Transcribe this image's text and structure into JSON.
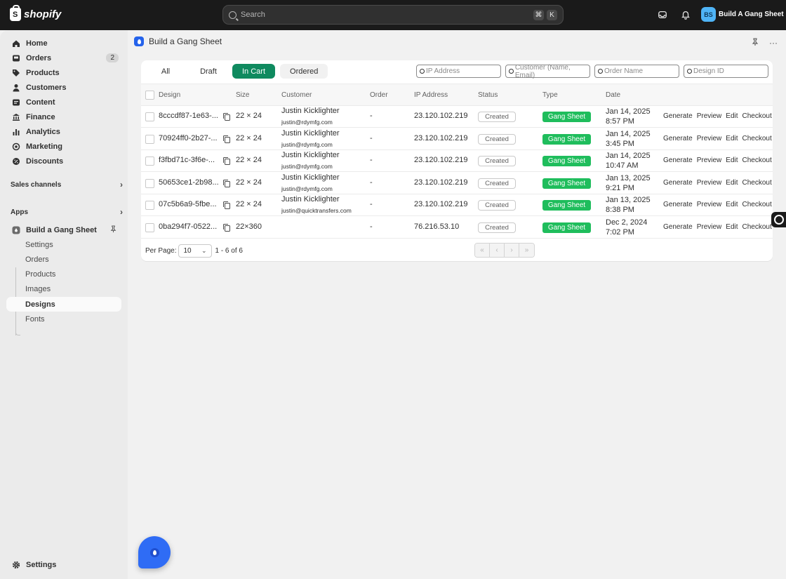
{
  "topbar": {
    "logo_text": "shopify",
    "logo_glyph": "S",
    "search_placeholder": "Search",
    "shortcut_keys": [
      "⌘",
      "K"
    ],
    "store_initials": "BS",
    "store_name": "Build A Gang Sheet"
  },
  "sidebar": {
    "nav": [
      {
        "label": "Home",
        "icon": "home-icon"
      },
      {
        "label": "Orders",
        "icon": "orders-icon",
        "badge": "2"
      },
      {
        "label": "Products",
        "icon": "tag-icon"
      },
      {
        "label": "Customers",
        "icon": "person-icon"
      },
      {
        "label": "Content",
        "icon": "content-icon"
      },
      {
        "label": "Finance",
        "icon": "bank-icon"
      },
      {
        "label": "Analytics",
        "icon": "bar-chart-icon"
      },
      {
        "label": "Marketing",
        "icon": "target-icon"
      },
      {
        "label": "Discounts",
        "icon": "discount-icon"
      }
    ],
    "sales_channels_label": "Sales channels",
    "apps_label": "Apps",
    "app_name": "Build a Gang Sheet",
    "app_sub_items": [
      "Settings",
      "Orders",
      "Products",
      "Images",
      "Designs",
      "Fonts"
    ],
    "active_sub_item": "Designs",
    "settings_label": "Settings"
  },
  "page": {
    "title": "Build a Gang Sheet",
    "more_label": "···"
  },
  "tabs": [
    {
      "label": "All",
      "state": "ghost"
    },
    {
      "label": "Draft",
      "state": "ghost"
    },
    {
      "label": "In Cart",
      "state": "active"
    },
    {
      "label": "Ordered",
      "state": "plain"
    }
  ],
  "filters": {
    "ip_placeholder": "IP Address",
    "customer_placeholder": "Customer (Name, Email)",
    "order_placeholder": "Order Name",
    "design_placeholder": "Design ID"
  },
  "table": {
    "headers": {
      "design": "Design",
      "size": "Size",
      "customer": "Customer",
      "order": "Order",
      "ip": "IP Address",
      "status": "Status",
      "type": "Type",
      "date": "Date"
    },
    "actions": [
      "Generate",
      "Preview",
      "Edit",
      "Checkout"
    ],
    "rows": [
      {
        "design": "8cccdf87-1e63-...",
        "size": "22 × 24",
        "customer_name": "Justin Kicklighter",
        "customer_email": "justin@rdymfg.com",
        "order": "-",
        "ip": "23.120.102.219",
        "status": "Created",
        "type": "Gang Sheet",
        "date_line1": "Jan 14, 2025",
        "date_line2": "8:57 PM"
      },
      {
        "design": "70924ff0-2b27-...",
        "size": "22 × 24",
        "customer_name": "Justin Kicklighter",
        "customer_email": "justin@rdymfg.com",
        "order": "-",
        "ip": "23.120.102.219",
        "status": "Created",
        "type": "Gang Sheet",
        "date_line1": "Jan 14, 2025",
        "date_line2": "3:45 PM"
      },
      {
        "design": "f3fbd71c-3f6e-...",
        "size": "22 × 24",
        "customer_name": "Justin Kicklighter",
        "customer_email": "justin@rdymfg.com",
        "order": "-",
        "ip": "23.120.102.219",
        "status": "Created",
        "type": "Gang Sheet",
        "date_line1": "Jan 14, 2025",
        "date_line2": "10:47 AM"
      },
      {
        "design": "50653ce1-2b98...",
        "size": "22 × 24",
        "customer_name": "Justin Kicklighter",
        "customer_email": "justin@rdymfg.com",
        "order": "-",
        "ip": "23.120.102.219",
        "status": "Created",
        "type": "Gang Sheet",
        "date_line1": "Jan 13, 2025",
        "date_line2": "9:21 PM"
      },
      {
        "design": "07c5b6a9-5fbe...",
        "size": "22 × 24",
        "customer_name": "Justin Kicklighter",
        "customer_email": "justin@quicktransfers.com",
        "order": "-",
        "ip": "23.120.102.219",
        "status": "Created",
        "type": "Gang Sheet",
        "date_line1": "Jan 13, 2025",
        "date_line2": "8:38 PM"
      },
      {
        "design": "0ba294f7-0522...",
        "size": "22×360",
        "customer_name": "",
        "customer_email": "",
        "order": "-",
        "ip": "76.216.53.10",
        "status": "Created",
        "type": "Gang Sheet",
        "date_line1": "Dec 2, 2024",
        "date_line2": "7:02 PM"
      }
    ]
  },
  "pagination": {
    "per_page_label": "Per Page:",
    "per_page_value": "10",
    "range_text": "1 - 6 of 6",
    "buttons": [
      "«",
      "‹",
      "›",
      "»"
    ]
  },
  "colors": {
    "tab_active": "#0f8a5f",
    "type_badge": "#1fbd5c",
    "fab": "#2f6cf5"
  }
}
